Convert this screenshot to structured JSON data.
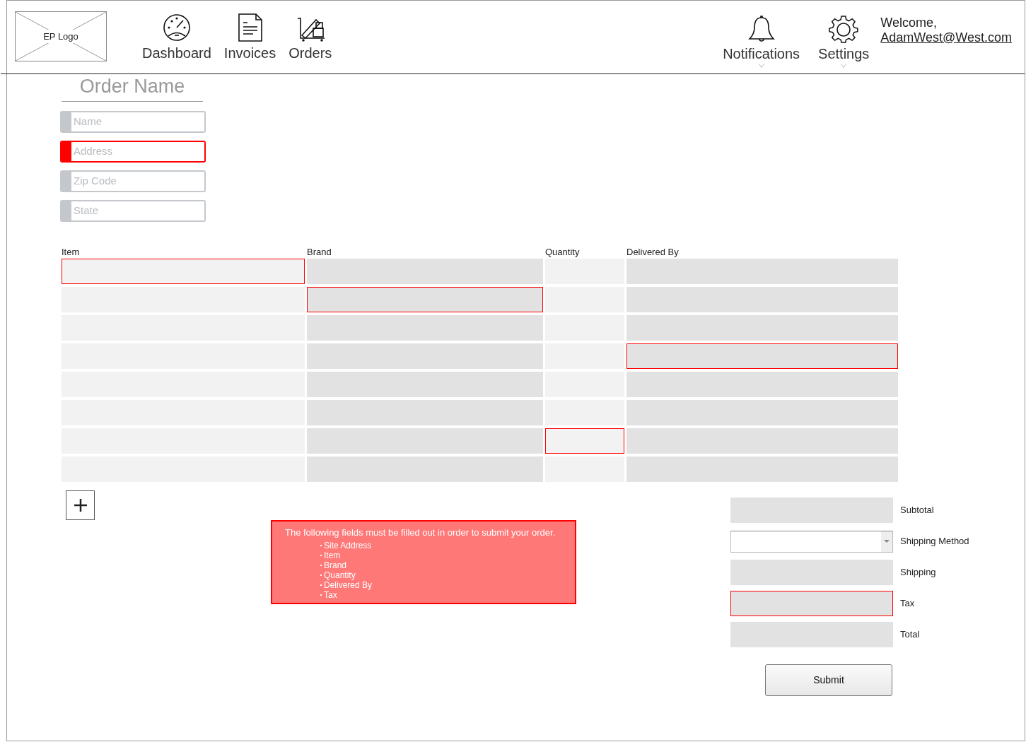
{
  "header": {
    "logo": "EP Logo",
    "nav": [
      {
        "kind": "dashboard",
        "label": "Dashboard"
      },
      {
        "kind": "invoices",
        "label": "Invoices"
      },
      {
        "kind": "orders",
        "label": "Orders"
      }
    ],
    "menus": [
      {
        "kind": "bell",
        "label": "Notifications"
      },
      {
        "kind": "gear",
        "label": "Settings"
      }
    ],
    "welcome": "Welcome,",
    "user": "AdamWest@West.com"
  },
  "order_title": "Order Name",
  "fields": [
    {
      "placeholder": "Name",
      "invalid": false
    },
    {
      "placeholder": "Address",
      "invalid": true
    },
    {
      "placeholder": "Zip Code",
      "invalid": false
    },
    {
      "placeholder": "State",
      "invalid": false
    }
  ],
  "table": {
    "columns": [
      "Item",
      "Brand",
      "Quantity",
      "Delivered By"
    ],
    "rows": [
      {
        "cells": [
          {
            "invalid": true
          },
          {
            "invalid": false
          },
          {
            "invalid": false
          },
          {
            "invalid": false
          }
        ]
      },
      {
        "cells": [
          {
            "invalid": false
          },
          {
            "invalid": true
          },
          {
            "invalid": false
          },
          {
            "invalid": false
          }
        ]
      },
      {
        "cells": [
          {
            "invalid": false
          },
          {
            "invalid": false
          },
          {
            "invalid": false
          },
          {
            "invalid": false
          }
        ]
      },
      {
        "cells": [
          {
            "invalid": false
          },
          {
            "invalid": false
          },
          {
            "invalid": false
          },
          {
            "invalid": true
          }
        ]
      },
      {
        "cells": [
          {
            "invalid": false
          },
          {
            "invalid": false
          },
          {
            "invalid": false
          },
          {
            "invalid": false
          }
        ]
      },
      {
        "cells": [
          {
            "invalid": false
          },
          {
            "invalid": false
          },
          {
            "invalid": false
          },
          {
            "invalid": false
          }
        ]
      },
      {
        "cells": [
          {
            "invalid": false
          },
          {
            "invalid": false
          },
          {
            "invalid": true
          },
          {
            "invalid": false
          }
        ]
      },
      {
        "cells": [
          {
            "invalid": false
          },
          {
            "invalid": false
          },
          {
            "invalid": false
          },
          {
            "invalid": false
          }
        ]
      }
    ]
  },
  "error": {
    "message": "The following fields must be filled out in order to submit your order.",
    "items": [
      "Site Address",
      "Item",
      "Brand",
      "Quantity",
      "Delivered By",
      "Tax"
    ]
  },
  "summary": [
    {
      "kind": "box",
      "label": "Subtotal",
      "invalid": false
    },
    {
      "kind": "select",
      "label": "Shipping Method",
      "invalid": false
    },
    {
      "kind": "box",
      "label": "Shipping",
      "invalid": false
    },
    {
      "kind": "box",
      "label": "Tax",
      "invalid": true
    },
    {
      "kind": "box",
      "label": "Total",
      "invalid": false
    }
  ],
  "submit": "Submit"
}
